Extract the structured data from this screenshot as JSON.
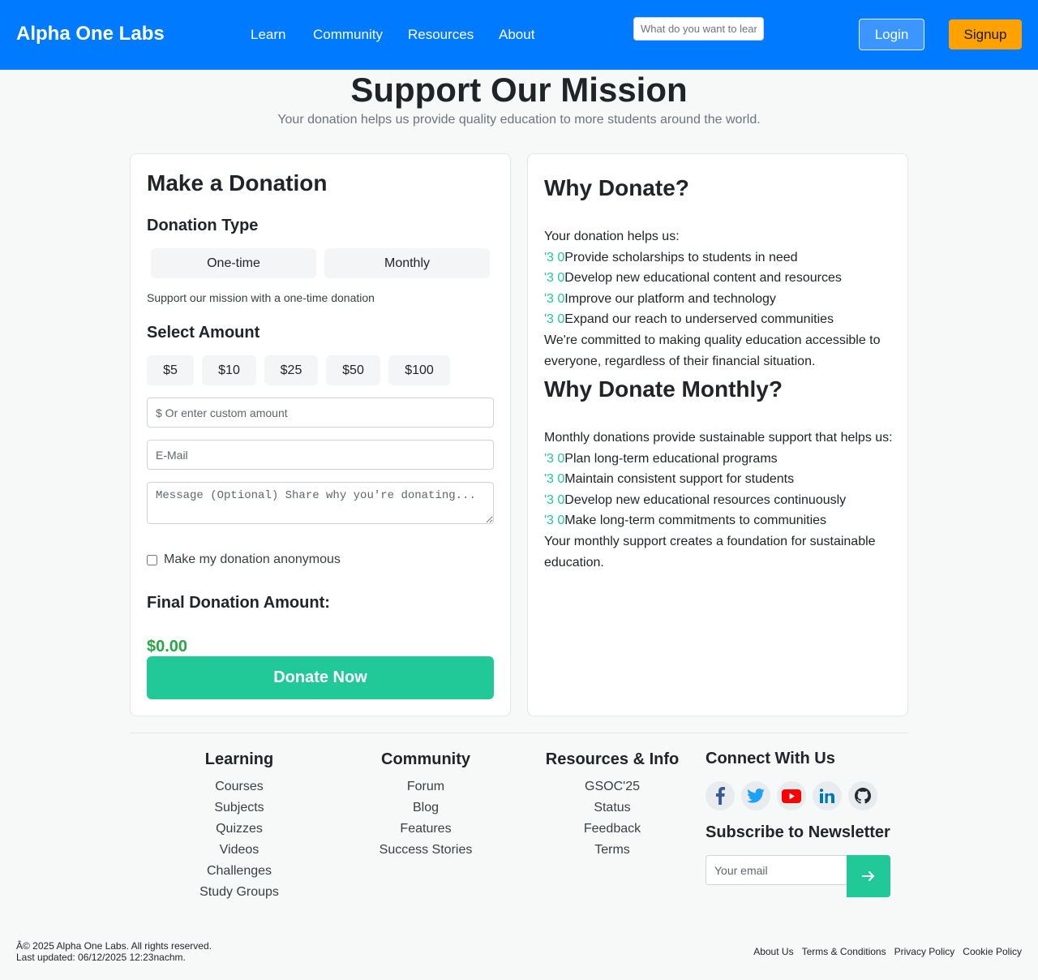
{
  "header": {
    "brand": "Alpha One Labs",
    "nav": [
      "Learn",
      "Community",
      "Resources",
      "About"
    ],
    "search_placeholder": "What do you want to learn?",
    "login": "Login",
    "signup": "Signup",
    "colors": {
      "bar": "#007bff",
      "signup": "#ffa200"
    }
  },
  "hero": {
    "title": "Support Our Mission",
    "subtitle": "Your donation helps us provide quality education to more students around the world."
  },
  "donation_form": {
    "title": "Make a Donation",
    "type_heading": "Donation Type",
    "types": [
      "One-time",
      "Monthly"
    ],
    "type_description": "Support our mission with a one-time donation",
    "amount_heading": "Select Amount",
    "amounts": [
      "$5",
      "$10",
      "$25",
      "$50",
      "$100"
    ],
    "custom_amount_placeholder": "$ Or enter custom amount",
    "email_placeholder": "E-Mail",
    "message_placeholder": "Message (Optional) Share why you're donating...",
    "anonymous_label": "Make my donation anonymous",
    "final_heading": "Final Donation Amount:",
    "final_amount": "$0.00",
    "donate_button": "Donate Now",
    "accent": "#20c997"
  },
  "why": {
    "title": "Why Donate?",
    "intro": "Your donation helps us:",
    "check_glyph": "'3 0",
    "items": [
      "Provide scholarships to students in need",
      "Develop new educational content and resources",
      "Improve our platform and technology",
      "Expand our reach to underserved communities"
    ],
    "closing": "We're committed to making quality education accessible to everyone, regardless of their financial situation."
  },
  "why_monthly": {
    "title": "Why Donate Monthly?",
    "intro": "Monthly donations provide sustainable support that helps us:",
    "items": [
      "Plan long-term educational programs",
      "Maintain consistent support for students",
      "Develop new educational resources continuously",
      "Make long-term commitments to communities"
    ],
    "closing": "Your monthly support creates a foundation for sustainable education."
  },
  "footer": {
    "learning": {
      "title": "Learning",
      "links": [
        "Courses",
        "Subjects",
        "Quizzes",
        "Videos",
        "Challenges",
        "Study Groups"
      ]
    },
    "community": {
      "title": "Community",
      "links": [
        "Forum",
        "Blog",
        "Features",
        "Success Stories"
      ]
    },
    "resources": {
      "title": "Resources & Info",
      "links": [
        "GSOC'25",
        "Status",
        "Feedback",
        "Terms"
      ]
    },
    "connect_title": "Connect With Us",
    "social_icons": [
      "facebook-icon",
      "twitter-icon",
      "youtube-icon",
      "linkedin-icon",
      "github-icon"
    ],
    "newsletter_title": "Subscribe to Newsletter",
    "newsletter_placeholder": "Your email",
    "copyright": "Â© 2025 Alpha One Labs. All rights reserved.",
    "last_updated": "Last updated: 06/12/2025 12:23nachm.",
    "bottom_links": [
      "About Us",
      "Terms & Conditions",
      "Privacy Policy",
      "Cookie Policy"
    ]
  }
}
